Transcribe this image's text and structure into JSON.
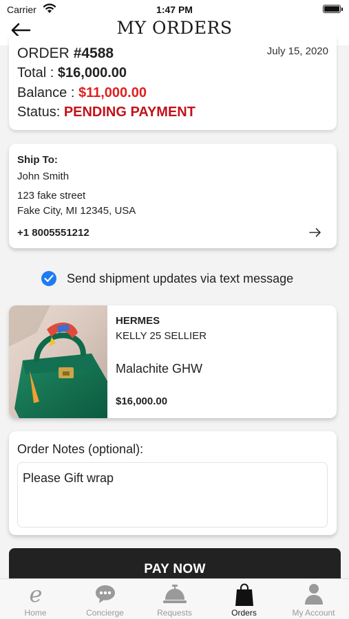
{
  "status_bar": {
    "carrier": "Carrier",
    "time": "1:47 PM"
  },
  "header": {
    "title": "MY ORDERS"
  },
  "order": {
    "number_label": "ORDER ",
    "number": "#4588",
    "date": "July 15, 2020",
    "total_label": "Total : ",
    "total": "$16,000.00",
    "balance_label": "Balance : ",
    "balance": "$11,000.00",
    "status_label": "Status: ",
    "status": "PENDING PAYMENT"
  },
  "shipping": {
    "label": "Ship To:",
    "name": "John Smith",
    "street": "123 fake street",
    "city_line": "Fake City, MI 12345, USA",
    "phone": "+1 8005551212"
  },
  "sms_option": {
    "checked": true,
    "label": "Send shipment updates via text message"
  },
  "product": {
    "brand": "HERMES",
    "model": "KELLY 25 SELLIER",
    "color": "Malachite GHW",
    "price": "$16,000.00"
  },
  "notes": {
    "label": "Order Notes (optional):",
    "value": "Please Gift wrap"
  },
  "pay_button": {
    "label": "PAY NOW"
  },
  "tabs": [
    {
      "label": "Home",
      "icon": "home-e-icon",
      "active": false
    },
    {
      "label": "Concierge",
      "icon": "chat-bubble-icon",
      "active": false
    },
    {
      "label": "Requests",
      "icon": "service-bell-icon",
      "active": false
    },
    {
      "label": "Orders",
      "icon": "shopping-bag-icon",
      "active": true
    },
    {
      "label": "My Account",
      "icon": "person-icon",
      "active": false
    }
  ],
  "colors": {
    "accent_blue": "#1e7cf2",
    "balance_red": "#e02020",
    "status_red": "#c4111b",
    "button_dark": "#222222"
  }
}
